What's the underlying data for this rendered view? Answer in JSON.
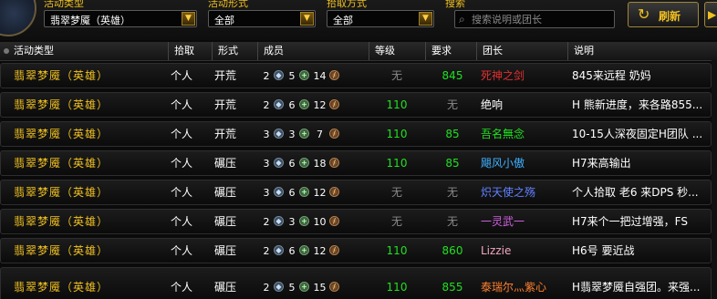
{
  "filters": {
    "type_label": "活动类型",
    "type_value": "翡翠梦魇（英雄）",
    "form_label": "活动形式",
    "form_value": "全部",
    "pick_label": "拾取方式",
    "pick_value": "全部",
    "search_label": "搜索",
    "search_placeholder": "搜索说明或团长",
    "refresh_label": "刷新"
  },
  "columns": {
    "type": "活动类型",
    "pick": "拾取",
    "form": "形式",
    "members": "成员",
    "level": "等级",
    "req": "要求",
    "leader": "团长",
    "desc": "说明"
  },
  "colors": {
    "accent_gold": "#f0c020",
    "level_green": "#20e020",
    "muted_gray": "#8a8a8a"
  },
  "icons": {
    "tank": "tank-role-icon",
    "healer": "healer-role-icon",
    "dps": "dps-role-icon",
    "refresh": "refresh-icon",
    "search": "search-icon"
  },
  "rows": [
    {
      "type": "翡翠梦魇（英雄）",
      "pick": "个人",
      "form": "开荒",
      "tank": "2",
      "heal": "5",
      "dps": "14",
      "level": "无",
      "req": "845",
      "leader": "死神之剑",
      "leader_color": "#e03030",
      "desc": "845来远程   奶妈"
    },
    {
      "type": "翡翠梦魇（英雄）",
      "pick": "个人",
      "form": "开荒",
      "tank": "2",
      "heal": "6",
      "dps": "12",
      "level": "110",
      "req": "无",
      "leader": "绝响",
      "leader_color": "#ffffff",
      "desc": "H 熊新进度，来各路855..."
    },
    {
      "type": "翡翠梦魇（英雄）",
      "pick": "个人",
      "form": "开荒",
      "tank": "3",
      "heal": "3",
      "dps": "7",
      "level": "110",
      "req": "85",
      "leader": "吾名無念",
      "leader_color": "#20e020",
      "desc": "10-15人深夜固定H团队 ..."
    },
    {
      "type": "翡翠梦魇（英雄）",
      "pick": "个人",
      "form": "碾压",
      "tank": "3",
      "heal": "6",
      "dps": "18",
      "level": "110",
      "req": "85",
      "leader": "飓风小傲",
      "leader_color": "#40b0ff",
      "desc": "H7来高输出"
    },
    {
      "type": "翡翠梦魇（英雄）",
      "pick": "个人",
      "form": "碾压",
      "tank": "3",
      "heal": "6",
      "dps": "12",
      "level": "无",
      "req": "无",
      "leader": "炽天使之殇",
      "leader_color": "#6080ff",
      "desc": "个人拾取 老6 来DPS  秒..."
    },
    {
      "type": "翡翠梦魇（英雄）",
      "pick": "个人",
      "form": "碾压",
      "tank": "2",
      "heal": "3",
      "dps": "10",
      "level": "无",
      "req": "无",
      "leader": "一灵武一",
      "leader_color": "#d060e0",
      "desc": "H7来个一把过增强，FS"
    },
    {
      "type": "翡翠梦魇（英雄）",
      "pick": "个人",
      "form": "碾压",
      "tank": "2",
      "heal": "6",
      "dps": "12",
      "level": "110",
      "req": "860",
      "leader": "Lizzie",
      "leader_color": "#f0a8c0",
      "desc": "H6号 要近战"
    },
    {
      "type": "翡翠梦魇（英雄）",
      "pick": "个人",
      "form": "碾压",
      "tank": "2",
      "heal": "5",
      "dps": "15",
      "level": "110",
      "req": "855",
      "leader": "泰瑞尔灬紫心",
      "leader_color": "#ff8030",
      "desc": "H翡翠梦魇自强团。来强..."
    }
  ]
}
